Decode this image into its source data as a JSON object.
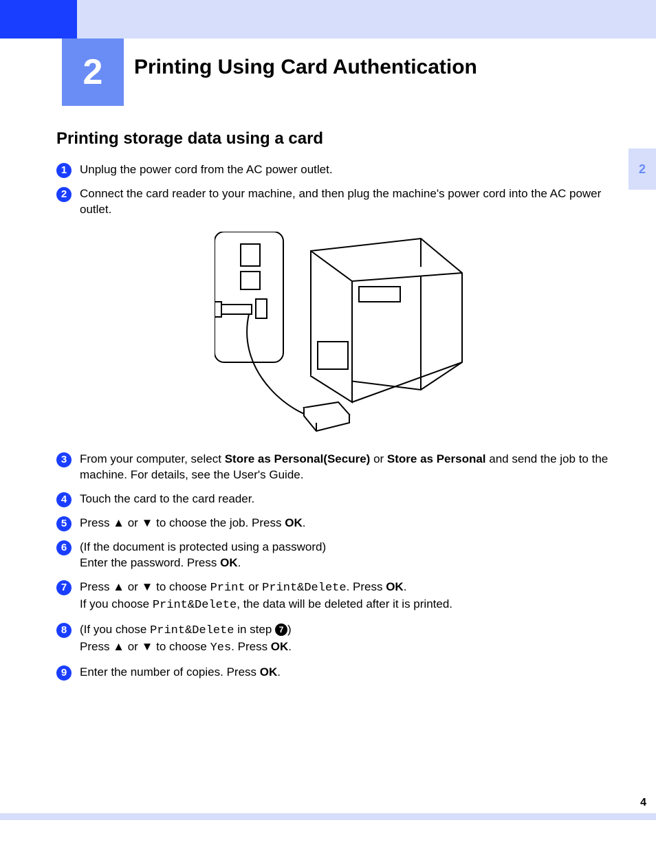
{
  "chapter_number": "2",
  "chapter_title": "Printing Using Card Authentication",
  "side_tab": "2",
  "section_title": "Printing storage data using a card",
  "steps": {
    "s1": "Unplug the power cord from the AC power outlet.",
    "s2": "Connect the card reader to your machine, and then plug the machine's power cord into the AC power outlet.",
    "s3_a": "From your computer, select ",
    "s3_b1": "Store as Personal(Secure)",
    "s3_c": " or ",
    "s3_b2": "Store as Personal",
    "s3_d": " and send the job to the machine. For details, see the User's Guide.",
    "s4": "Touch the card to the card reader.",
    "s5_a": "Press ▲ or ▼ to choose the job. Press ",
    "s5_ok": "OK",
    "s5_b": ".",
    "s6_a": "(If the document is protected using a password)",
    "s6_b": "Enter the password. Press ",
    "s6_ok": "OK",
    "s6_c": ".",
    "s7_a": "Press ▲ or ▼ to choose ",
    "s7_m1": "Print",
    "s7_b": " or ",
    "s7_m2": "Print&Delete",
    "s7_c": ". Press ",
    "s7_ok": "OK",
    "s7_d": ".",
    "s7_e": "If you choose ",
    "s7_m3": "Print&Delete",
    "s7_f": ", the data will be deleted after it is printed.",
    "s8_a": "(If you chose ",
    "s8_m1": "Print&Delete",
    "s8_b": " in step ",
    "s8_ref": "7",
    "s8_c": ")",
    "s8_d": "Press ▲ or ▼ to choose ",
    "s8_m2": "Yes",
    "s8_e": ". Press ",
    "s8_ok": "OK",
    "s8_f": ".",
    "s9_a": "Enter the number of copies. Press ",
    "s9_ok": "OK",
    "s9_b": "."
  },
  "page_number": "4"
}
